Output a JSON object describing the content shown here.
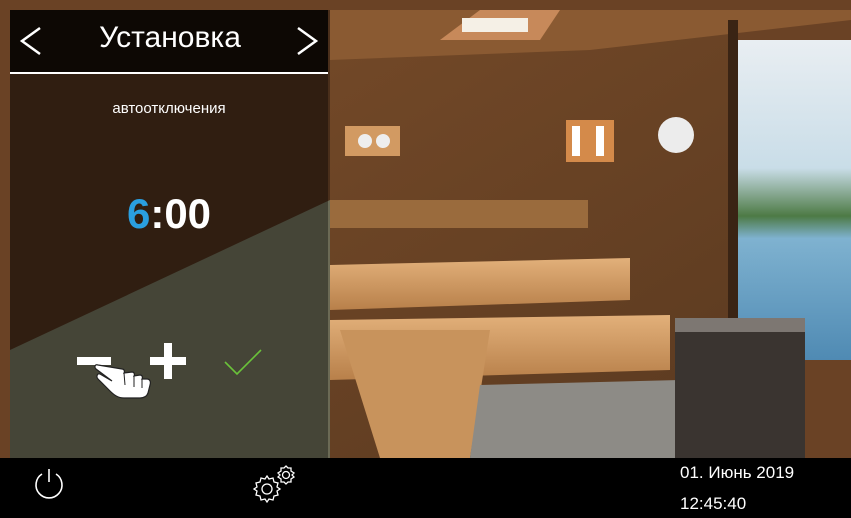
{
  "header": {
    "title": "Установка",
    "prev_icon": "chevron-left-icon",
    "next_icon": "chevron-right-icon"
  },
  "setting": {
    "label": "автоотключения",
    "hours": "6",
    "separator": ":",
    "minutes": "00"
  },
  "controls": {
    "minus_icon": "minus-icon",
    "plus_icon": "plus-icon",
    "confirm_icon": "check-icon",
    "hint_icon": "hand-pointer-icon"
  },
  "footer": {
    "power_icon": "power-icon",
    "settings_icon": "gears-icon",
    "date": "01. Июнь 2019",
    "time": "12:45:40"
  },
  "colors": {
    "accent": "#2a9fe0",
    "confirm": "#6ac23a",
    "text": "#ffffff"
  }
}
